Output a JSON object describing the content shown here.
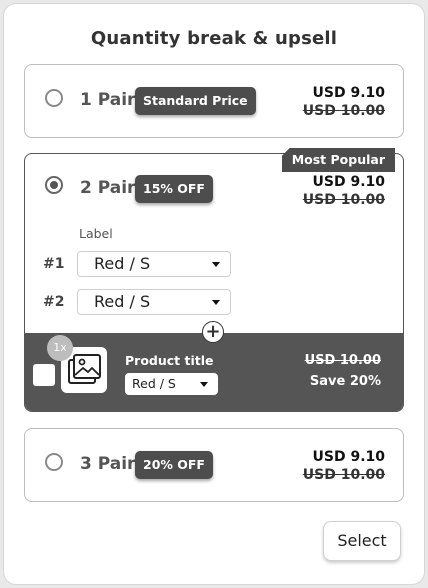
{
  "heading": "Quantity break & upsell",
  "options": [
    {
      "qty": "1 Pair",
      "tag": "Standard Price",
      "price": "USD 9.10",
      "compare": "USD 10.00",
      "selected": false
    },
    {
      "qty": "2 Pair",
      "tag": "15% OFF",
      "price": "USD 9.10",
      "compare": "USD 10.00",
      "selected": true,
      "ribbon": "Most Popular"
    },
    {
      "qty": "3 Pair",
      "tag": "20% OFF",
      "price": "USD 9.10",
      "compare": "USD 10.00",
      "selected": false
    }
  ],
  "variants": {
    "label": "Label",
    "rows": [
      {
        "num": "#1",
        "value": "Red / S"
      },
      {
        "num": "#2",
        "value": "Red / S"
      }
    ]
  },
  "upsell": {
    "badge": "1x",
    "title": "Product title",
    "variant": "Red / S",
    "compare": "USD 10.00",
    "save": "Save 20%",
    "plus": "+"
  },
  "select_button": "Select",
  "colors": {
    "dark": "#4d4d4d",
    "upsell_bg": "#555555"
  }
}
